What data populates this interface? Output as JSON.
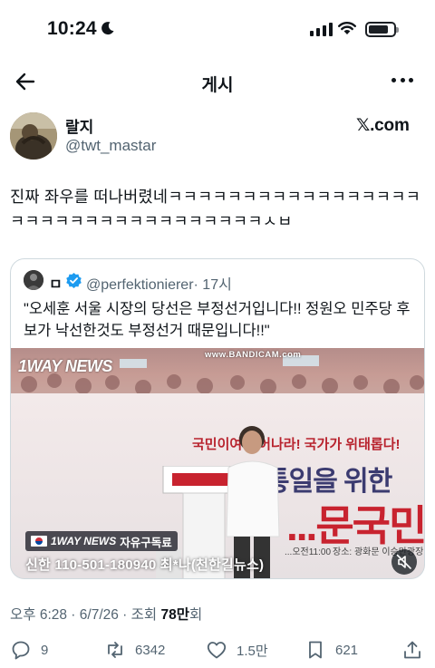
{
  "status_bar": {
    "time": "10:24",
    "battery_level": 0.82
  },
  "header": {
    "title": "게시"
  },
  "author": {
    "name": "랄지",
    "handle": "@twt_mastar",
    "source": "𝕏.com"
  },
  "tweet": {
    "text": "진짜 좌우를 떠나버렸네ㅋㅋㅋㅋㅋㅋㅋㅋㅋㅋㅋㅋㅋㅋㅋㅋㅋㅋㅋㅋㅋㅋㅋㅋㅋㅋㅋㅋㅋㅋㅋㅋㅋㅋㅅㅂ"
  },
  "quote": {
    "name": "ㅁ",
    "handle": "@perfektionierer",
    "time": "· 17시",
    "text": "\"오세훈 서울 시장의 당선은 부정선거입니다!! 정원오 민주당 후보가 낙선한것도 부정선거 때문입니다!!\"",
    "video": {
      "logo": "1WAY NEWS",
      "watermark": "www.BANDICAM.com",
      "banner_red": "국민이여 일어나라! 국가가 위태롭다!",
      "banner_line1": "...통일을 위한",
      "banner_line2": "...문국민대",
      "banner_time": "...오전11:00",
      "banner_place": "장소: 광화문 이승만광장",
      "subscribe_logo": "1WAY NEWS",
      "subscribe_text": "자유구독료",
      "account": "신한 110-501-180940 최*나(천한길뉴스)"
    }
  },
  "meta": {
    "prefix": "오후 6:28 · 6/7/26 · 조회 ",
    "views": "78만",
    "suffix": "회"
  },
  "actions": {
    "replies": "9",
    "reposts": "6342",
    "likes": "1.5만",
    "bookmarks": "621"
  },
  "colors": {
    "text": "#0f1419",
    "secondary": "#536471",
    "border": "#cfd9de",
    "verified": "#1d9bf0"
  }
}
